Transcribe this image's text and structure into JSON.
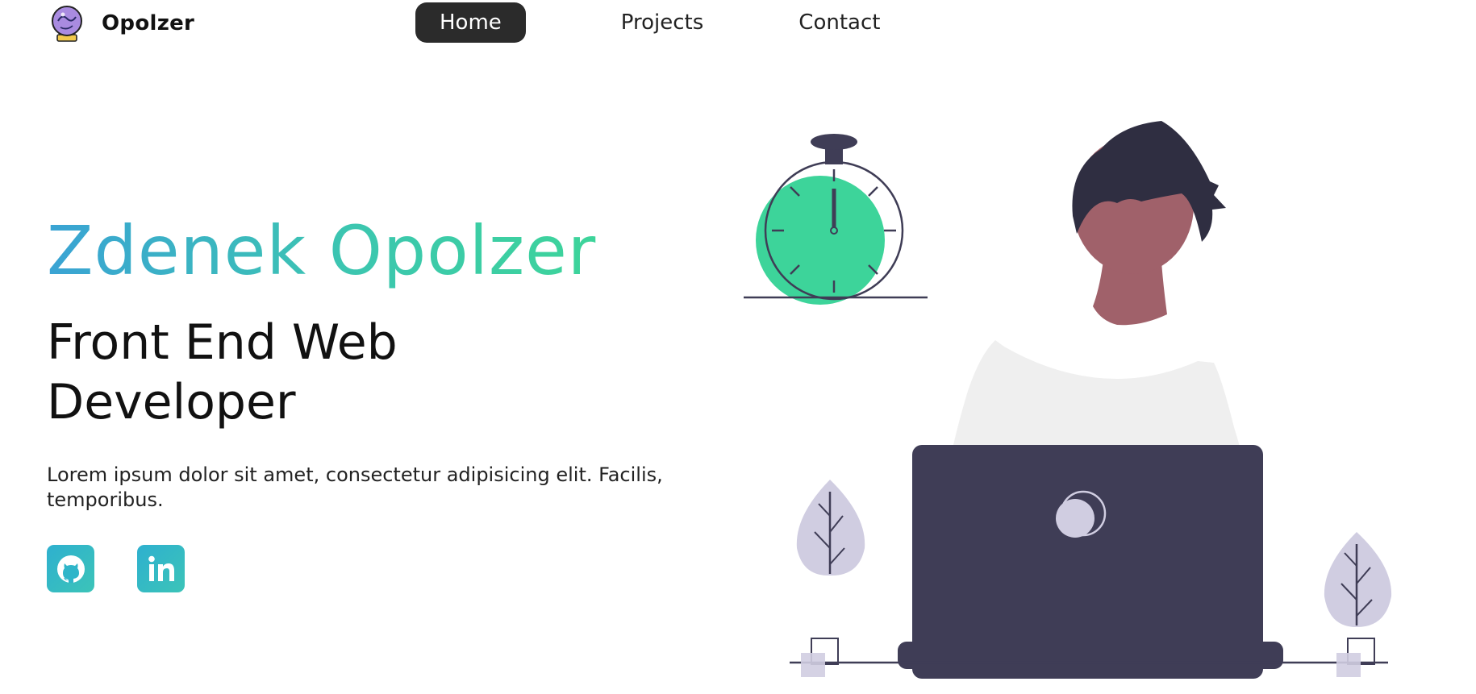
{
  "brand": {
    "name": "Opolzer",
    "logo_icon": "crystal-ball-icon"
  },
  "nav": {
    "home": "Home",
    "projects": "Projects",
    "contact": "Contact",
    "active": "Home"
  },
  "hero": {
    "name": "Zdenek Opolzer",
    "role": "Front End Web Developer",
    "description": "Lorem ipsum dolor sit amet, consectetur adipisicing elit. Facilis, temporibus."
  },
  "socials": [
    {
      "icon": "github-icon"
    },
    {
      "icon": "linkedin-icon"
    }
  ],
  "illustration": {
    "description_icon": "developer-with-laptop-and-stopwatch-illustration"
  },
  "colors": {
    "accent_green": "#3dd49a",
    "accent_blue": "#3aa3d4",
    "nav_active_bg": "#2b2b2b",
    "laptop": "#3f3d56",
    "plant": "#d0cde1"
  }
}
